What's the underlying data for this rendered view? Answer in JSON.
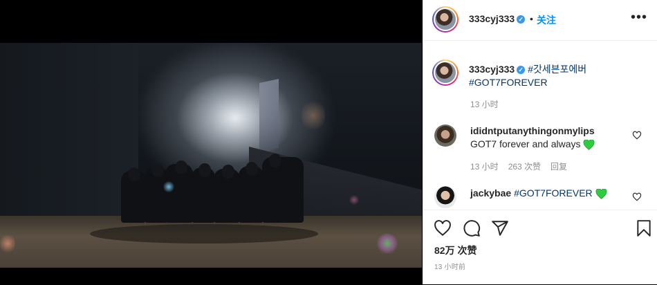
{
  "post": {
    "username": "333cyj333",
    "follow_label": "关注",
    "separator": "•",
    "more_label": "•••",
    "caption": {
      "username": "333cyj333",
      "hashtag1": "#갓세븐포에버",
      "hashtag2": "#GOT7FOREVER",
      "time": "13 小时"
    }
  },
  "comments": [
    {
      "username": "ididntputanythingonmylips",
      "text": "GOT7 forever and always",
      "time": "13 小时",
      "likes": "263 次赞",
      "reply": "回复"
    },
    {
      "username": "jackybae",
      "text": "#GOT7FOREVER"
    }
  ],
  "footer": {
    "likes": "82万 次赞",
    "time": "13 小时前"
  },
  "colors": {
    "accent": "#0095f6",
    "verified": "#3897f0",
    "hashtag": "#00376b",
    "muted": "#8e8e8e",
    "heart_emoji": "#2ecc40"
  },
  "icons": [
    "verified-badge-icon",
    "heart-icon",
    "comment-icon",
    "share-icon",
    "bookmark-icon",
    "green-heart-emoji"
  ]
}
